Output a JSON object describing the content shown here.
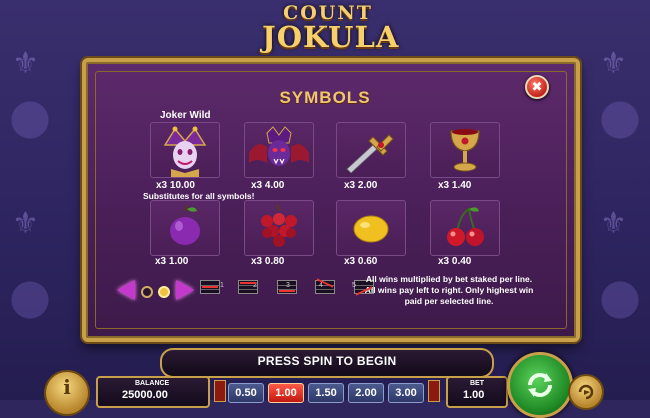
{
  "game": {
    "logo_line1": "COUNT",
    "logo_line2": "JOKULA"
  },
  "paytable": {
    "title": "SYMBOLS",
    "close_symbol": "✖",
    "wild_title": "Joker Wild",
    "wild_note": "Substitutes for all symbols!",
    "symbols": [
      {
        "name": "joker",
        "icon": "joker-icon",
        "pay": "x3 10.00"
      },
      {
        "name": "vampire",
        "icon": "vampire-icon",
        "pay": "x3 4.00"
      },
      {
        "name": "stake",
        "icon": "stake-icon",
        "pay": "x3 2.00"
      },
      {
        "name": "goblet",
        "icon": "goblet-icon",
        "pay": "x3 1.40"
      },
      {
        "name": "plum",
        "icon": "plum-icon",
        "pay": "x3 1.00"
      },
      {
        "name": "grapes",
        "icon": "grapes-icon",
        "pay": "x3 0.80"
      },
      {
        "name": "lemon",
        "icon": "lemon-icon",
        "pay": "x3 0.60"
      },
      {
        "name": "cherries",
        "icon": "cherries-icon",
        "pay": "x3 0.40"
      }
    ],
    "paylines": [
      "1",
      "2",
      "3",
      "4",
      "5"
    ],
    "rules": [
      "All wins multiplied by bet staked per line.",
      "All wins pay left to right. Only highest win",
      "paid per selected line."
    ],
    "page_count": 2,
    "current_page": 2
  },
  "controls": {
    "message": "PRESS SPIN TO BEGIN",
    "info_symbol": "i",
    "balance_label": "BALANCE",
    "balance_value": "25000.00",
    "bet_label": "BET",
    "bet_value": "1.00",
    "coin_values": [
      "0.50",
      "1.00",
      "1.50",
      "2.00",
      "3.00"
    ],
    "selected_coin": "1.00"
  },
  "colors": {
    "accent_gold": "#c9a04a",
    "panel_purple": "#4a1f58",
    "spin_green": "#1f8a25",
    "coin_selected": "#c0180f"
  }
}
